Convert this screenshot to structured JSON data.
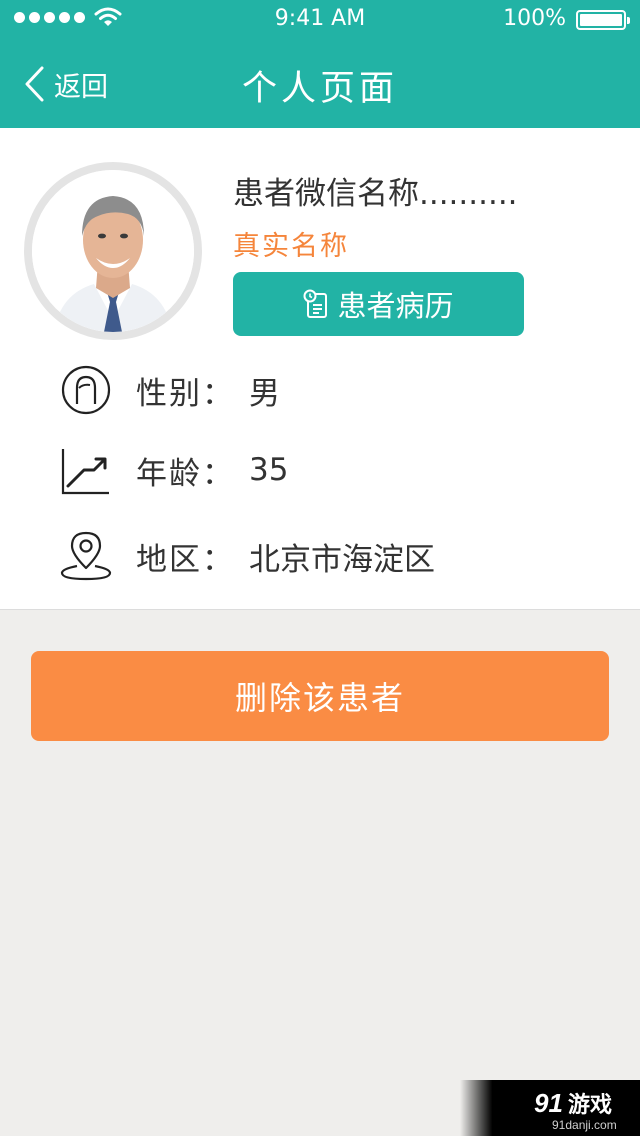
{
  "status_bar": {
    "time": "9:41 AM",
    "battery_percent": "100%",
    "battery_level": 1.0,
    "signal_bars": 5
  },
  "nav": {
    "back_label": "返回",
    "title": "个人页面"
  },
  "profile": {
    "wechat_name": "患者微信名称..........",
    "real_name": "真实名称",
    "records_button": "患者病历"
  },
  "details": [
    {
      "icon": "person-icon",
      "label": "性别：",
      "value": "男"
    },
    {
      "icon": "trend-icon",
      "label": "年龄：",
      "value": "35"
    },
    {
      "icon": "location-pin-icon",
      "label": "地区：",
      "value": "北京市海淀区"
    }
  ],
  "actions": {
    "delete_label": "删除该患者"
  },
  "watermark": {
    "text": "91游戏",
    "domain": "91danji.com"
  },
  "colors": {
    "header": "#22b3a5",
    "accent_orange": "#fa8c44",
    "real_name": "#f5853b",
    "background": "#efeeec"
  }
}
